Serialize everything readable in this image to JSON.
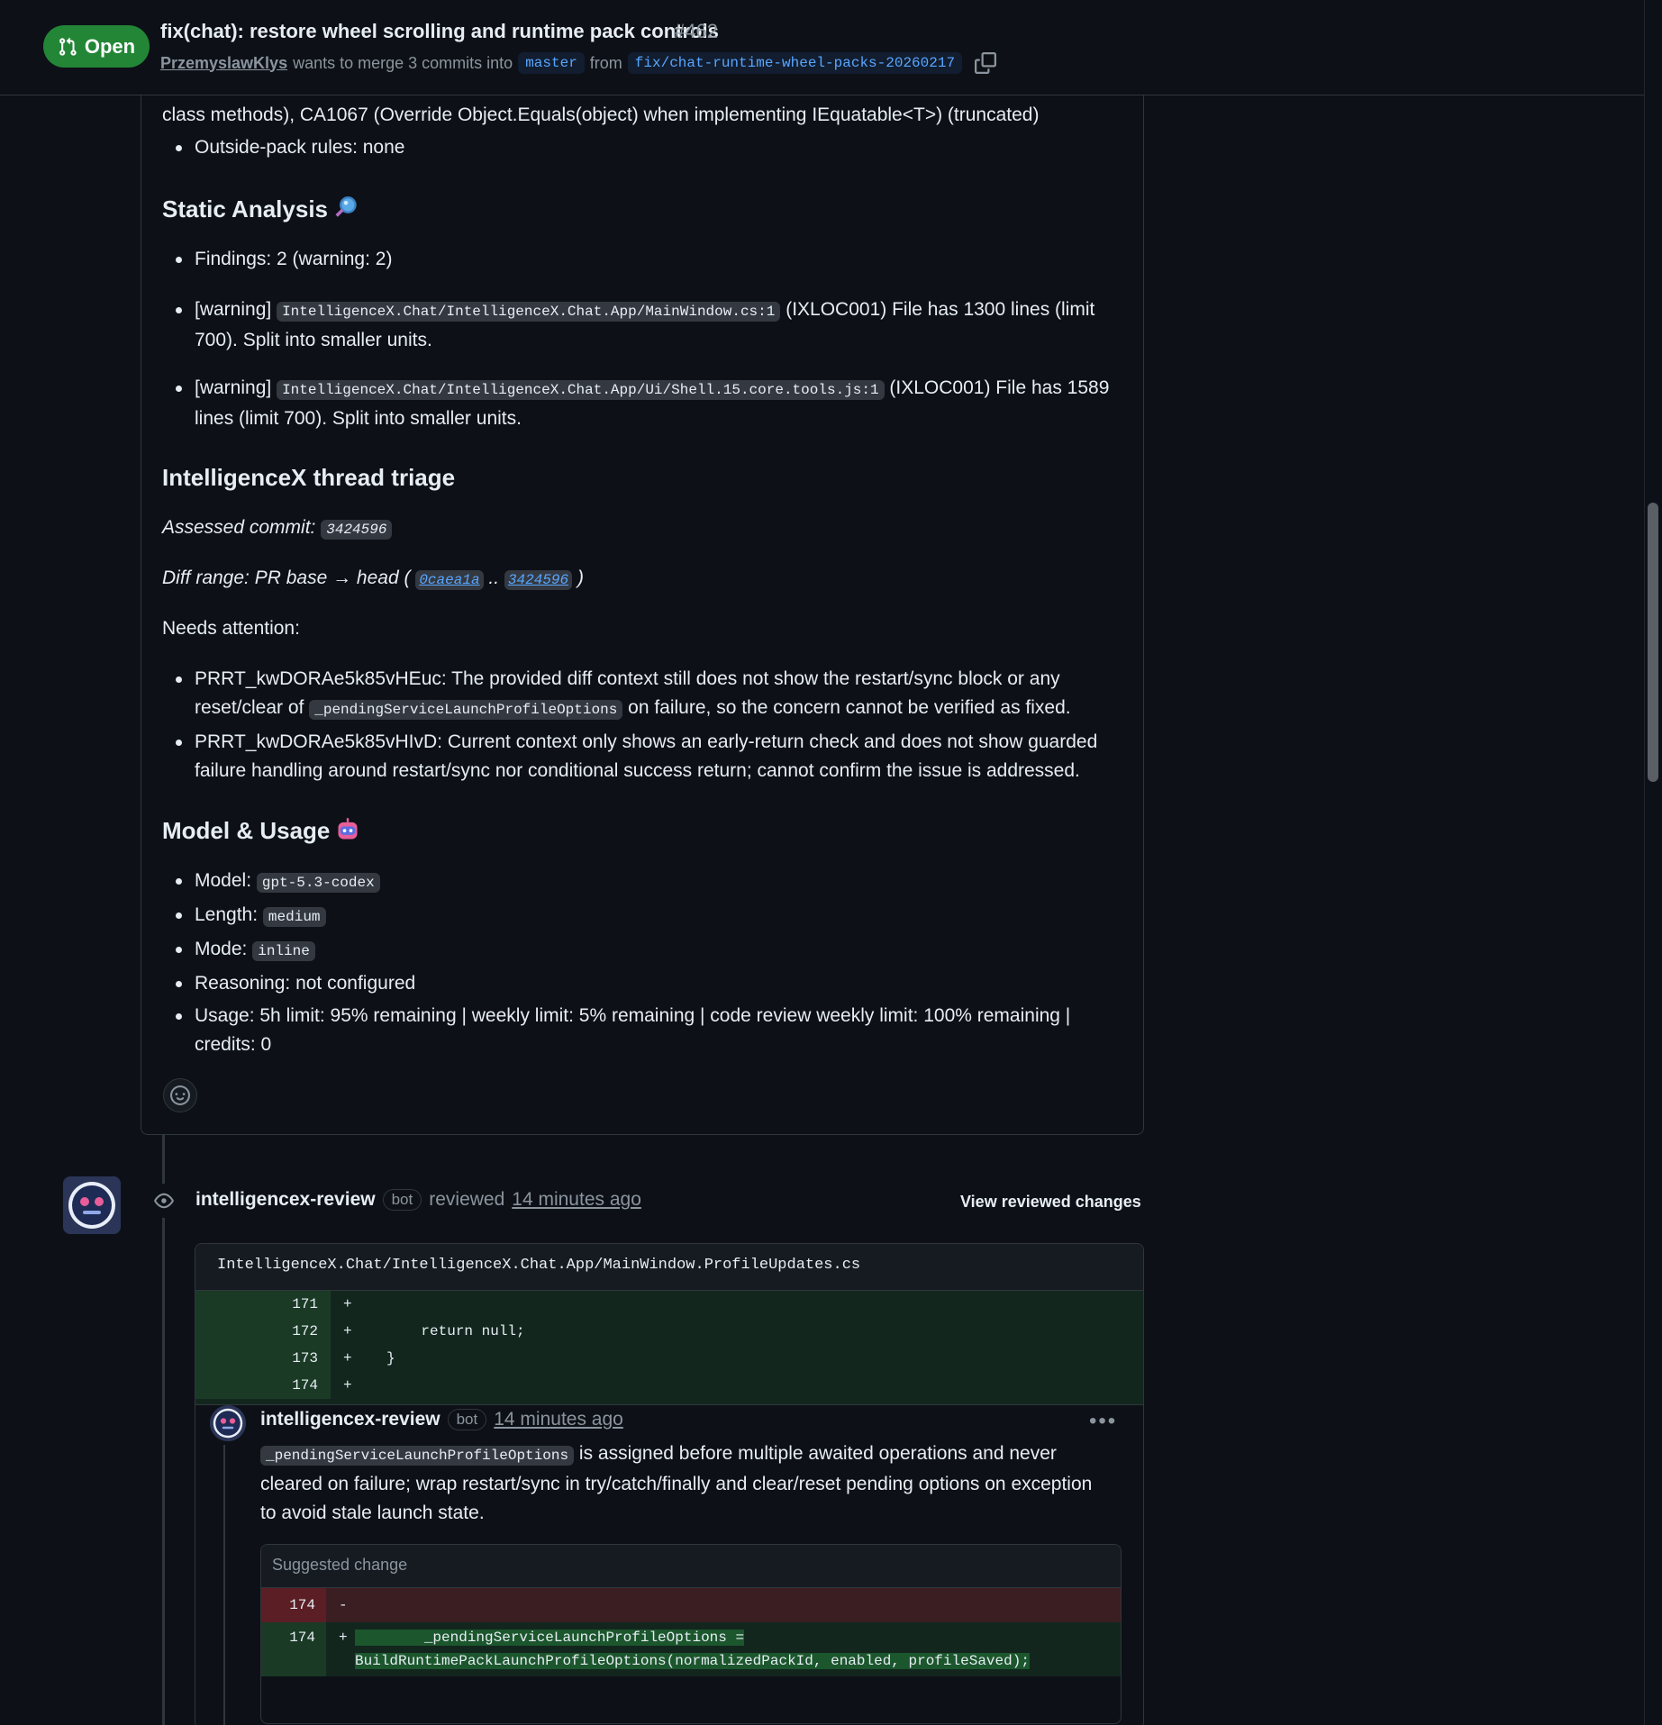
{
  "header": {
    "state": "Open",
    "title": "fix(chat): restore wheel scrolling and runtime pack controls",
    "number": "#462",
    "author": "PrzemyslawKlys",
    "merge_text": "wants to merge 3 commits into",
    "base_branch": "master",
    "from_text": "from",
    "head_branch": "fix/chat-runtime-wheel-packs-20260217"
  },
  "body": {
    "truncated_line": "class methods), CA1067 (Override Object.Equals(object) when implementing IEquatable<T>) (truncated)",
    "outside_pack": "Outside-pack rules: none",
    "static_heading": "Static Analysis",
    "findings": "Findings: 2 (warning: 2)",
    "warn1_tag": "[warning]",
    "warn1_path": "IntelligenceX.Chat/IntelligenceX.Chat.App/MainWindow.cs:1",
    "warn1_text_a": "(IXLOC001) File has 1300 lines (limit",
    "warn1_text_b": "700). Split into smaller units.",
    "warn2_tag": "[warning]",
    "warn2_path": "IntelligenceX.Chat/IntelligenceX.Chat.App/Ui/Shell.15.core.tools.js:1",
    "warn2_text_a": "(IXLOC001) File has 1589",
    "warn2_text_b": "lines (limit 700). Split into smaller units.",
    "triage_heading": "IntelligenceX thread triage",
    "assessed_label": "Assessed commit:",
    "assessed_sha": "3424596",
    "diff_label": "Diff range: PR base → head (",
    "diff_base": "0caea1a",
    "diff_sep": "..",
    "diff_head": "3424596",
    "diff_close": ")",
    "needs_attention": "Needs attention:",
    "att1_a": "PRRT_kwDORAe5k85vHEuc: The provided diff context still does not show the restart/sync block or any",
    "att1_b_pre": "reset/clear of",
    "att1_b_code": "_pendingServiceLaunchProfileOptions",
    "att1_b_post": "on failure, so the concern cannot be verified as fixed.",
    "att2_a": "PRRT_kwDORAe5k85vHIvD: Current context only shows an early-return check and does not show guarded",
    "att2_b": "failure handling around restart/sync nor conditional success return; cannot confirm the issue is addressed.",
    "model_heading": "Model & Usage",
    "model_label": "Model:",
    "model_value": "gpt-5.3-codex",
    "length_label": "Length:",
    "length_value": "medium",
    "mode_label": "Mode:",
    "mode_value": "inline",
    "reasoning": "Reasoning: not configured",
    "usage_a": "Usage: 5h limit: 95% remaining | weekly limit: 5% remaining | code review weekly limit: 100% remaining |",
    "usage_b": "credits: 0"
  },
  "review": {
    "actor": "intelligencex-review",
    "bot": "bot",
    "action": "reviewed",
    "time": "14 minutes ago",
    "view_changes": "View reviewed changes",
    "file": "IntelligenceX.Chat/IntelligenceX.Chat.App/MainWindow.ProfileUpdates.cs",
    "lines": [
      {
        "num": "171",
        "code": "+"
      },
      {
        "num": "172",
        "code": "+        return null;"
      },
      {
        "num": "173",
        "code": "+    }"
      },
      {
        "num": "174",
        "code": "+"
      }
    ],
    "reply": {
      "actor": "intelligencex-review",
      "bot": "bot",
      "time": "14 minutes ago",
      "code": "_pendingServiceLaunchProfileOptions",
      "text_a": "is assigned before multiple awaited operations and never",
      "text_b": "cleared on failure; wrap restart/sync in try/catch/finally and clear/reset pending options on exception",
      "text_c": "to avoid stale launch state.",
      "suggest_label": "Suggested change",
      "del_num": "174",
      "del_sign": "-",
      "add_num": "174",
      "add_sign": "+",
      "add_code_a": "        _pendingServiceLaunchProfileOptions =",
      "add_code_b": "BuildRuntimePackLaunchProfileOptions(normalizedPackId, enabled, profileSaved);"
    }
  }
}
